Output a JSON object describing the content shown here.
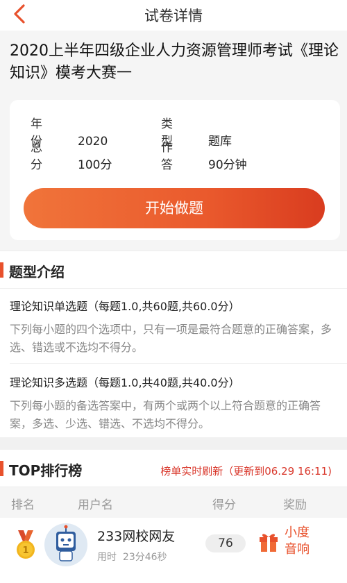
{
  "navbar": {
    "title": "试卷详情",
    "back_icon": "chevron-left-icon",
    "accent": "#e8512c"
  },
  "exam": {
    "title": "2020上半年四级企业人力资源管理师考试《理论知识》模考大赛一",
    "info": {
      "year_label": "年份",
      "year_value": "2020",
      "type_label": "类型",
      "type_value": "题库",
      "score_label": "总分",
      "score_value": "100分",
      "time_label": "作答",
      "time_value": "90分钟"
    },
    "start_button": "开始做题"
  },
  "question_types": {
    "heading": "题型介绍",
    "items": [
      {
        "name": "理论知识单选题（每题1.0,共60题,共60.0分）",
        "desc": "下列每小题的四个选项中，只有一项是最符合题意的正确答案，多选、错选或不选均不得分。"
      },
      {
        "name": "理论知识多选题（每题1.0,共40题,共40.0分）",
        "desc": "下列每小题的备选答案中，有两个或两个以上符合题意的正确答案，多选、少选、错选、不选均不得分。"
      }
    ]
  },
  "ranking": {
    "heading": "TOP排行榜",
    "refresh_note": "榜单实时刷新（更新到06.29 16:11)",
    "columns": {
      "rank": "排名",
      "user": "用户名",
      "score": "得分",
      "reward": "奖励"
    },
    "rows": [
      {
        "rank": "1",
        "rank_icon": "gold-medal-icon",
        "user": "233网校网友",
        "time_label": "用时",
        "time_value": "23分46秒",
        "score": "76",
        "reward_icon": "gift-icon",
        "reward_line1": "小度",
        "reward_line2": "音响"
      }
    ]
  }
}
